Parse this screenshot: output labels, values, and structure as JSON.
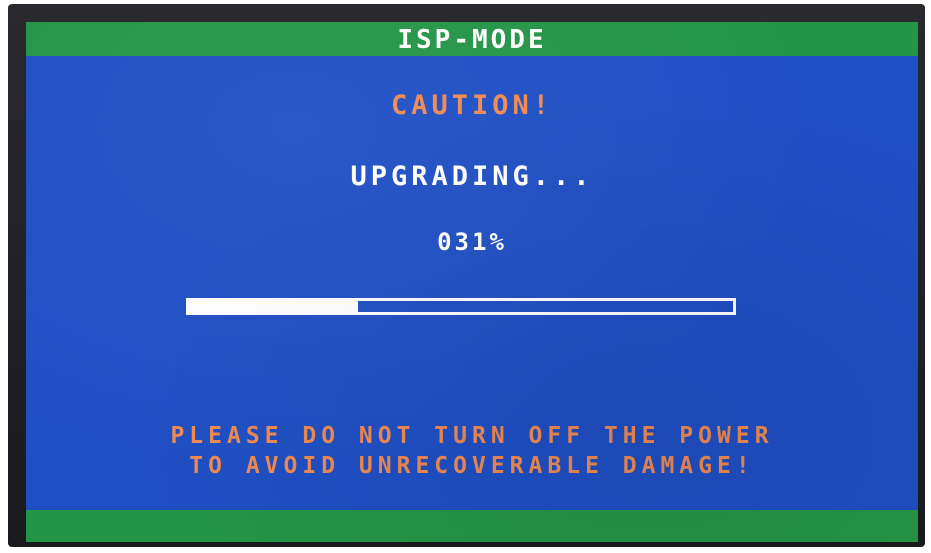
{
  "header": {
    "title": "ISP-MODE"
  },
  "main": {
    "caution": "CAUTION!",
    "status": "UPGRADING...",
    "progress_text": "031%",
    "progress_fraction": 0.31
  },
  "warning": {
    "line1": "PLEASE DO NOT TURN OFF THE POWER",
    "line2": "TO AVOID UNRECOVERABLE DAMAGE!"
  },
  "colors": {
    "screen_background": "#1f4fc4",
    "bar_green": "#249547",
    "warning_orange": "#f08a52",
    "text_white": "#ffffff"
  }
}
